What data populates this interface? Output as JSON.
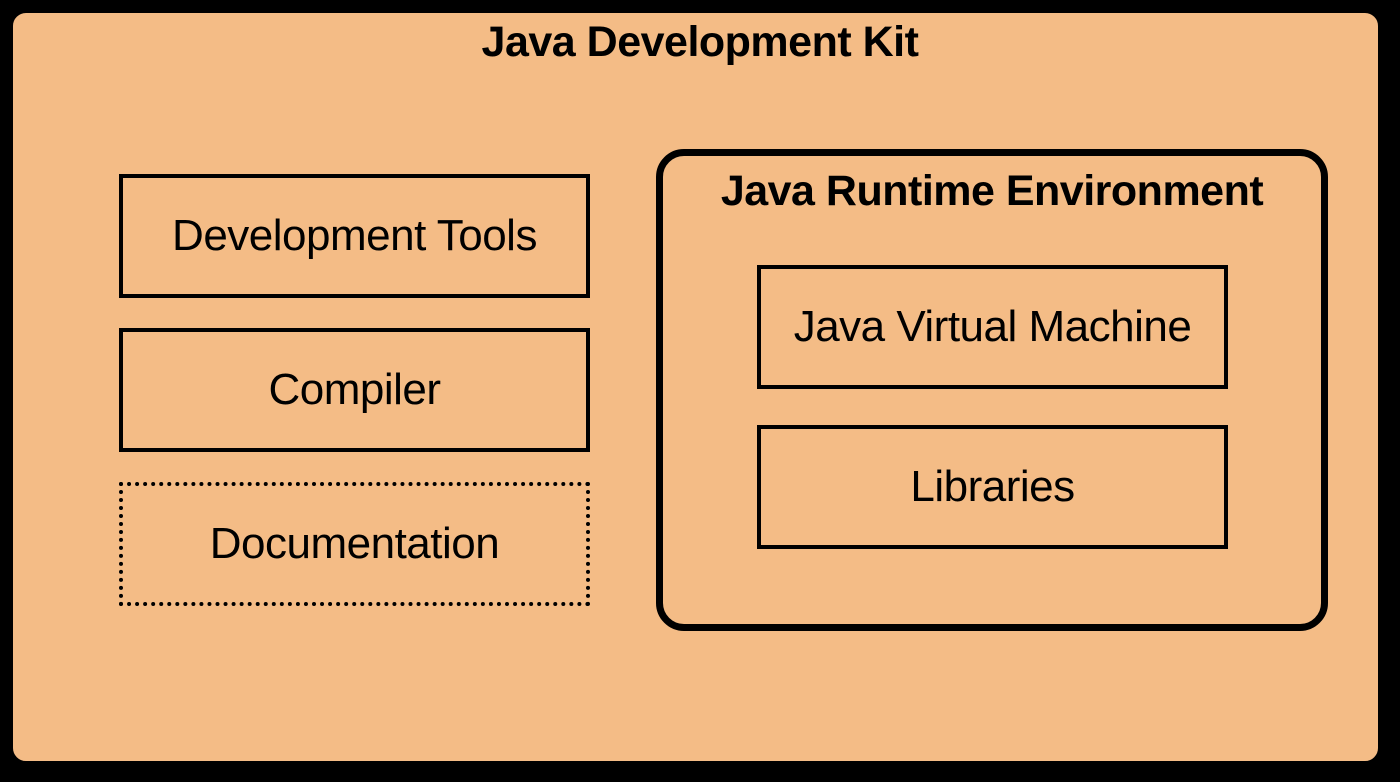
{
  "colors": {
    "background": "#f4bc86",
    "outline": "#000000"
  },
  "jdk": {
    "title": "Java Development Kit",
    "items": [
      {
        "label": "Development Tools",
        "style": "solid"
      },
      {
        "label": "Compiler",
        "style": "solid"
      },
      {
        "label": "Documentation",
        "style": "dotted"
      }
    ]
  },
  "jre": {
    "title": "Java Runtime Environment",
    "items": [
      {
        "label": "Java Virtual Machine",
        "style": "solid"
      },
      {
        "label": "Libraries",
        "style": "solid"
      }
    ]
  }
}
